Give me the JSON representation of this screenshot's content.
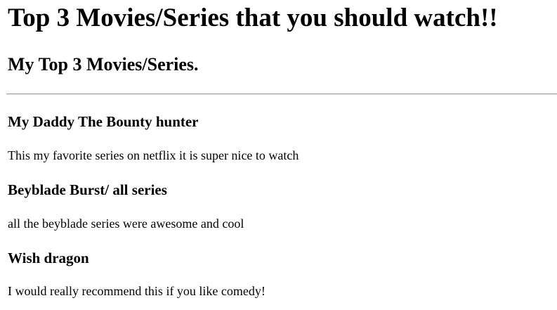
{
  "page": {
    "title": "Top 3 Movies/Series that you should watch!!",
    "subtitle": "My Top 3 Movies/Series."
  },
  "items": [
    {
      "title": "My Daddy The Bounty hunter",
      "description": "This my favorite series on netflix it is super nice to watch"
    },
    {
      "title": "Beyblade Burst/ all series",
      "description": "all the beyblade series were awesome and cool"
    },
    {
      "title": "Wish dragon",
      "description": "I would really recommend this if you like comedy!"
    }
  ],
  "colors": {
    "text": "#000000",
    "background": "#ffffff",
    "rule": "#9a9a9a"
  }
}
